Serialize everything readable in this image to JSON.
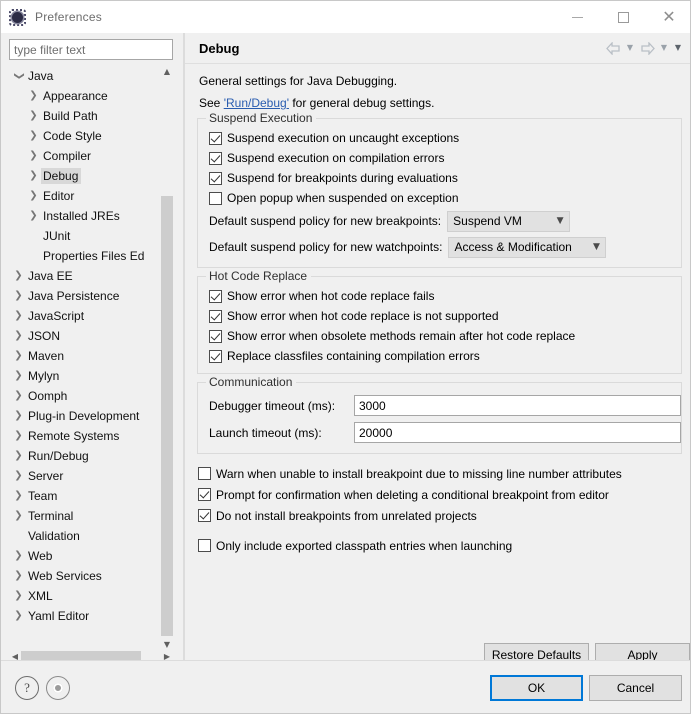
{
  "window": {
    "title": "Preferences",
    "icon": "preferences-gear-icon",
    "controls": {
      "minimize": "–",
      "maximize": "□",
      "close": "✕"
    }
  },
  "sidebar": {
    "filter": {
      "value": "",
      "placeholder": "type filter text"
    },
    "items": [
      {
        "label": "Java",
        "level": 1,
        "twisty": "expanded",
        "selected": false
      },
      {
        "label": "Appearance",
        "level": 2,
        "twisty": "collapsed",
        "selected": false
      },
      {
        "label": "Build Path",
        "level": 2,
        "twisty": "collapsed",
        "selected": false
      },
      {
        "label": "Code Style",
        "level": 2,
        "twisty": "collapsed",
        "selected": false
      },
      {
        "label": "Compiler",
        "level": 2,
        "twisty": "collapsed",
        "selected": false
      },
      {
        "label": "Debug",
        "level": 2,
        "twisty": "collapsed",
        "selected": true
      },
      {
        "label": "Editor",
        "level": 2,
        "twisty": "collapsed",
        "selected": false
      },
      {
        "label": "Installed JREs",
        "level": 2,
        "twisty": "collapsed",
        "selected": false
      },
      {
        "label": "JUnit",
        "level": 2,
        "twisty": "none",
        "selected": false
      },
      {
        "label": "Properties Files Ed",
        "level": 2,
        "twisty": "none",
        "selected": false
      },
      {
        "label": "Java EE",
        "level": 1,
        "twisty": "collapsed",
        "selected": false
      },
      {
        "label": "Java Persistence",
        "level": 1,
        "twisty": "collapsed",
        "selected": false
      },
      {
        "label": "JavaScript",
        "level": 1,
        "twisty": "collapsed",
        "selected": false
      },
      {
        "label": "JSON",
        "level": 1,
        "twisty": "collapsed",
        "selected": false
      },
      {
        "label": "Maven",
        "level": 1,
        "twisty": "collapsed",
        "selected": false
      },
      {
        "label": "Mylyn",
        "level": 1,
        "twisty": "collapsed",
        "selected": false
      },
      {
        "label": "Oomph",
        "level": 1,
        "twisty": "collapsed",
        "selected": false
      },
      {
        "label": "Plug-in Development",
        "level": 1,
        "twisty": "collapsed",
        "selected": false
      },
      {
        "label": "Remote Systems",
        "level": 1,
        "twisty": "collapsed",
        "selected": false
      },
      {
        "label": "Run/Debug",
        "level": 1,
        "twisty": "collapsed",
        "selected": false
      },
      {
        "label": "Server",
        "level": 1,
        "twisty": "collapsed",
        "selected": false
      },
      {
        "label": "Team",
        "level": 1,
        "twisty": "collapsed",
        "selected": false
      },
      {
        "label": "Terminal",
        "level": 1,
        "twisty": "collapsed",
        "selected": false
      },
      {
        "label": "Validation",
        "level": 1,
        "twisty": "none",
        "selected": false
      },
      {
        "label": "Web",
        "level": 1,
        "twisty": "collapsed",
        "selected": false
      },
      {
        "label": "Web Services",
        "level": 1,
        "twisty": "collapsed",
        "selected": false
      },
      {
        "label": "XML",
        "level": 1,
        "twisty": "collapsed",
        "selected": false
      },
      {
        "label": "Yaml Editor",
        "level": 1,
        "twisty": "collapsed",
        "selected": false
      }
    ]
  },
  "page": {
    "title": "Debug",
    "nav": {
      "back": "back-arrow-icon",
      "back_menu": "chevron-down-icon",
      "forward": "forward-arrow-icon",
      "forward_menu": "chevron-down-icon",
      "view_menu": "chevron-down-icon"
    },
    "intro_line1": "General settings for Java Debugging.",
    "intro_line2_prefix": "See ",
    "intro_link": "'Run/Debug'",
    "intro_line2_suffix": " for general debug settings.",
    "groups": [
      {
        "title": "Suspend Execution",
        "checkboxes": [
          {
            "label": "Suspend execution on uncaught exceptions",
            "checked": true
          },
          {
            "label": "Suspend execution on compilation errors",
            "checked": true
          },
          {
            "label": "Suspend for breakpoints during evaluations",
            "checked": true
          },
          {
            "label": "Open popup when suspended on exception",
            "checked": false
          }
        ],
        "combos": [
          {
            "label": "Default suspend policy for new breakpoints:",
            "value": "Suspend VM"
          },
          {
            "label": "Default suspend policy for new watchpoints:",
            "value": "Access & Modification"
          }
        ]
      },
      {
        "title": "Hot Code Replace",
        "checkboxes": [
          {
            "label": "Show error when hot code replace fails",
            "checked": true
          },
          {
            "label": "Show error when hot code replace is not supported",
            "checked": true
          },
          {
            "label": "Show error when obsolete methods remain after hot code replace",
            "checked": true
          },
          {
            "label": "Replace classfiles containing compilation errors",
            "checked": true
          }
        ]
      },
      {
        "title": "Communication",
        "fields": [
          {
            "label": "Debugger timeout (ms):",
            "value": "3000"
          },
          {
            "label": "Launch timeout (ms):",
            "value": "20000"
          }
        ]
      }
    ],
    "loose_checkboxes": [
      {
        "label": "Warn when unable to install breakpoint due to missing line number attributes",
        "checked": false
      },
      {
        "label": "Prompt for confirmation when deleting a conditional breakpoint from editor",
        "checked": true
      },
      {
        "label": "Do not install breakpoints from unrelated projects",
        "checked": true
      },
      {
        "label": "Only include exported classpath entries when launching",
        "checked": false
      }
    ],
    "buttons": {
      "restore_defaults": "Restore Defaults",
      "apply": "Apply"
    }
  },
  "footer": {
    "help_icon": "?",
    "record_icon": "recording-indicator-icon",
    "ok": "OK",
    "cancel": "Cancel"
  },
  "colors": {
    "accent": "#0078d7",
    "link": "#2a5db0",
    "dialog_bg": "#f0f0f0",
    "selection": "#d8d8d8"
  }
}
